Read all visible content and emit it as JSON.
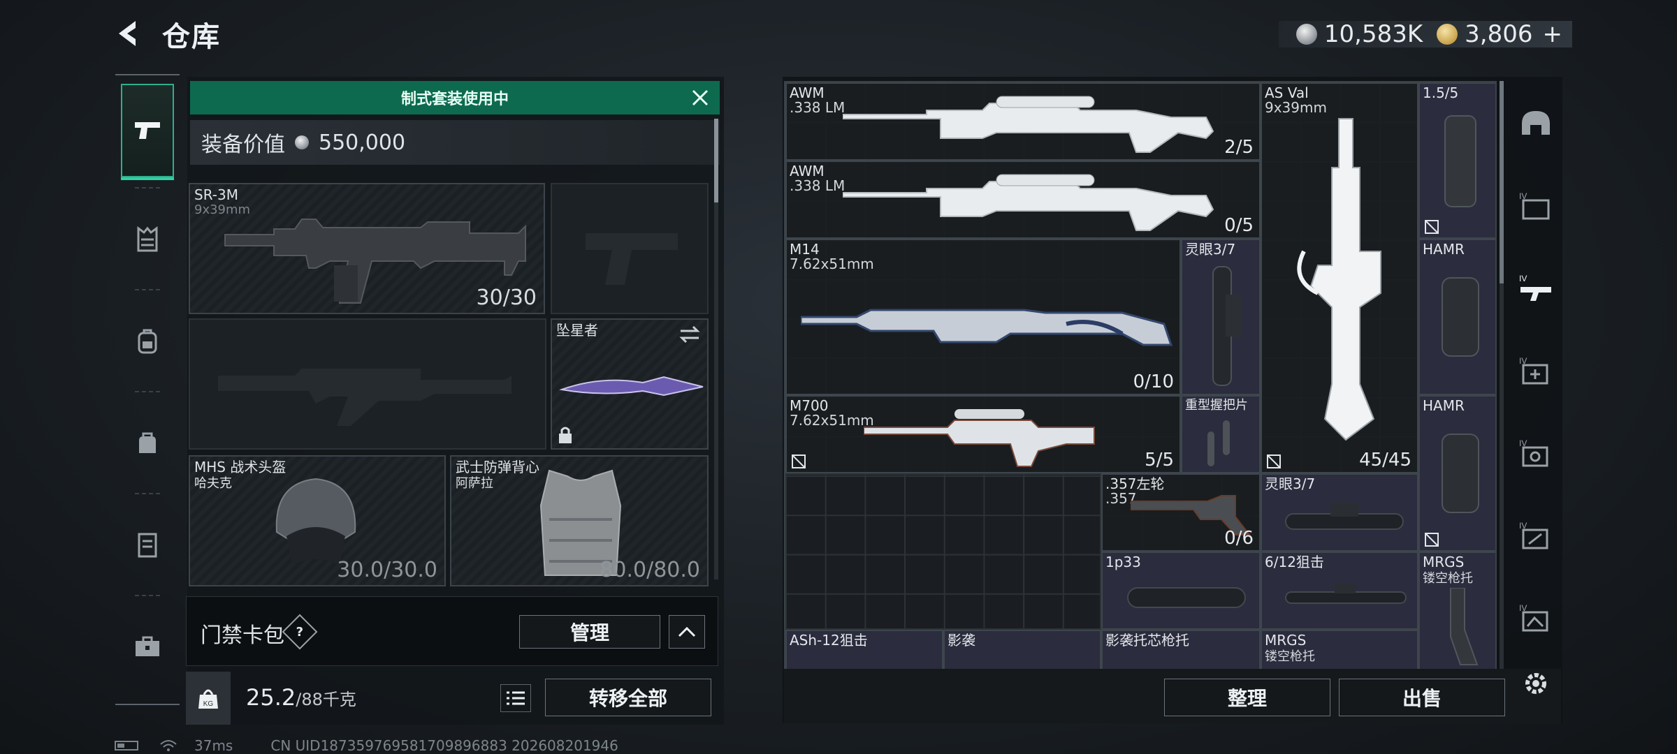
{
  "header": {
    "title": "仓库",
    "currency_silver": "10,583K",
    "currency_gold": "3,806",
    "currency_gold_plus": "+"
  },
  "left_rail": {
    "items": [
      {
        "icon": "pistol-icon",
        "active": true
      },
      {
        "icon": "vest-icon",
        "active": false
      },
      {
        "icon": "backpack-icon",
        "active": false
      },
      {
        "icon": "bag-icon",
        "active": false
      },
      {
        "icon": "locker-icon",
        "active": false
      },
      {
        "icon": "briefcase-icon",
        "active": false
      }
    ]
  },
  "loadout": {
    "banner": "制式套装使用中",
    "value_label": "装备价值",
    "value": "550,000",
    "primary": {
      "name": "SR-3M",
      "sub": "9x39mm",
      "count": "30/30"
    },
    "melee": {
      "name": "坠星者"
    },
    "helmet": {
      "name": "MHS 战术头盔",
      "sub": "哈夫克",
      "count": "30.0/30.0"
    },
    "armor": {
      "name": "武士防弹背心",
      "sub": "阿萨拉",
      "count": "80.0/80.0"
    },
    "card_bag_label": "门禁卡包",
    "help": "?",
    "manage": "管理",
    "weight": "25.2",
    "weight_max": "/88千克",
    "transfer_all": "转移全部"
  },
  "storage": {
    "items": [
      {
        "name": "AWM",
        "sub": ".338 LM",
        "count": "2/5"
      },
      {
        "name": "AWM",
        "sub": ".338 LM",
        "count": "0/5"
      },
      {
        "name": "AS Val",
        "sub": "9x39mm",
        "count": "45/45"
      },
      {
        "name": "1.5/5"
      },
      {
        "name": "M14",
        "sub": "7.62x51mm",
        "count": "0/10"
      },
      {
        "name": "灵眼3/7"
      },
      {
        "name": "HAMR"
      },
      {
        "name": "M700",
        "sub": "7.62x51mm",
        "count": "5/5"
      },
      {
        "name": "重型握把片"
      },
      {
        "name": "HAMR"
      },
      {
        "name": ".357左轮",
        "sub": ".357",
        "count": "0/6"
      },
      {
        "name": "灵眼3/7"
      },
      {
        "name": "1p33"
      },
      {
        "name": "6/12狙击"
      },
      {
        "name": "MRGS",
        "sub": "镂空枪托"
      },
      {
        "name": "ASh-12狙击"
      },
      {
        "name": "影袭"
      },
      {
        "name": "影袭托芯枪托"
      },
      {
        "name": "MRGS",
        "sub": "镂空枪托"
      }
    ],
    "sort": "整理",
    "sell": "出售"
  },
  "right_rail": {
    "filters": [
      "helmet-filter-icon",
      "tier4-folder-icon",
      "tier4-rifle-icon",
      "tier4-medkit-icon",
      "tier4-scope-icon",
      "tier4-grip-icon",
      "tier4-stock-icon"
    ]
  },
  "footer": {
    "ping": "37ms",
    "uid": "CN UID187359769581709896883 202608201946"
  },
  "colors": {
    "accent": "#2fd0a4",
    "banner": "#0d6a4e",
    "attachment_bg": "#2b2c3d"
  }
}
